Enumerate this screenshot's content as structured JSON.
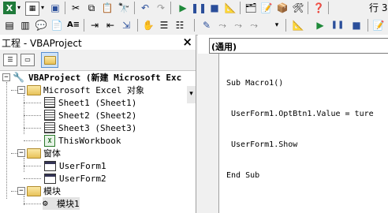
{
  "toolbar": {
    "right_label": "行 3"
  },
  "project_panel": {
    "title": "工程 - VBAProject",
    "close_glyph": "×",
    "tree": [
      {
        "label": "VBAProject (新建 Microsoft Exc"
      },
      {
        "label": "Microsoft Excel 对象"
      },
      {
        "label": "Sheet1 (Sheet1)"
      },
      {
        "label": "Sheet2 (Sheet2)"
      },
      {
        "label": "Sheet3 (Sheet3)"
      },
      {
        "label": "ThisWorkbook"
      },
      {
        "label": "窗体"
      },
      {
        "label": "UserForm1"
      },
      {
        "label": "UserForm2"
      },
      {
        "label": "模块"
      },
      {
        "label": "模块1"
      }
    ]
  },
  "code_panel": {
    "object_combo": "(通用)",
    "lines": [
      "Sub Macro1()",
      " UserForm1.OptBtn1.Value = ture",
      " UserForm1.Show",
      "End Sub"
    ]
  }
}
